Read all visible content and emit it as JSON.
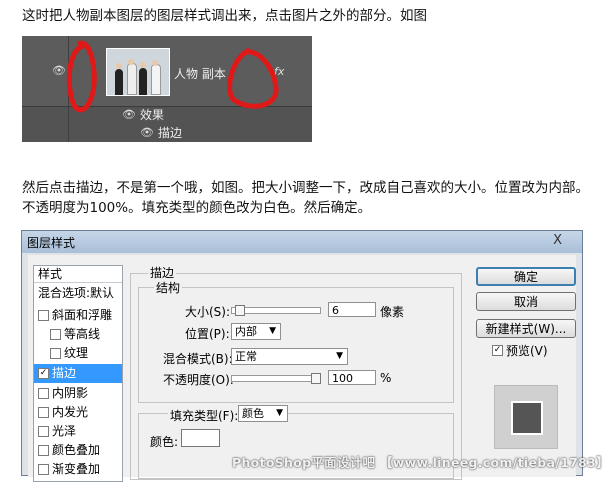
{
  "paragraph_1": "这时把人物副本图层的图层样式调出来，点击图片之外的部分。如图",
  "paragraph_2": "然后点击描边，不是第一个哦，如图。把大小调整一下，改成自己喜欢的大小。位置改为内部。不透明度为100%。填充类型的颜色改为白色。然后确定。",
  "layers_panel": {
    "layer_name": "人物 副本",
    "fx_label": "fx",
    "effects_label": "效果",
    "stroke_effect_label": "描边"
  },
  "dialog": {
    "title": "图层样式",
    "close": "X",
    "styles_header": "样式",
    "blend_default": "混合选项:默认",
    "styles": [
      {
        "label": "斜面和浮雕",
        "checked": false
      },
      {
        "label": "等高线",
        "checked": false
      },
      {
        "label": "纹理",
        "checked": false
      },
      {
        "label": "描边",
        "checked": true,
        "selected": true
      },
      {
        "label": "内阴影",
        "checked": false
      },
      {
        "label": "内发光",
        "checked": false
      },
      {
        "label": "光泽",
        "checked": false
      },
      {
        "label": "颜色叠加",
        "checked": false
      },
      {
        "label": "渐变叠加",
        "checked": false
      }
    ],
    "stroke_section": "描边",
    "structure_section": "结构",
    "size_label": "大小(S):",
    "size_value": "6",
    "size_unit": "像素",
    "size_slider_fraction": 0.05,
    "position_label": "位置(P):",
    "position_value": "内部",
    "blend_mode_label": "混合模式(B):",
    "blend_mode_value": "正常",
    "opacity_label": "不透明度(O):",
    "opacity_value": "100",
    "opacity_unit": "%",
    "opacity_slider_fraction": 1.0,
    "fill_type_label": "填充类型(F):",
    "fill_type_value": "颜色",
    "color_label": "颜色:",
    "stroke_color": "#ffffff",
    "ok_button": "确定",
    "cancel_button": "取消",
    "new_style_button": "新建样式(W)...",
    "preview_label": "预览(V)",
    "preview_checked": true
  },
  "watermark": "PhotoShop平面设计吧 【www.lineeg.com/tieba/1783】",
  "colors": {
    "annotation": "#e01818",
    "panel_bg": "#535353",
    "selection": "#3399ff"
  }
}
